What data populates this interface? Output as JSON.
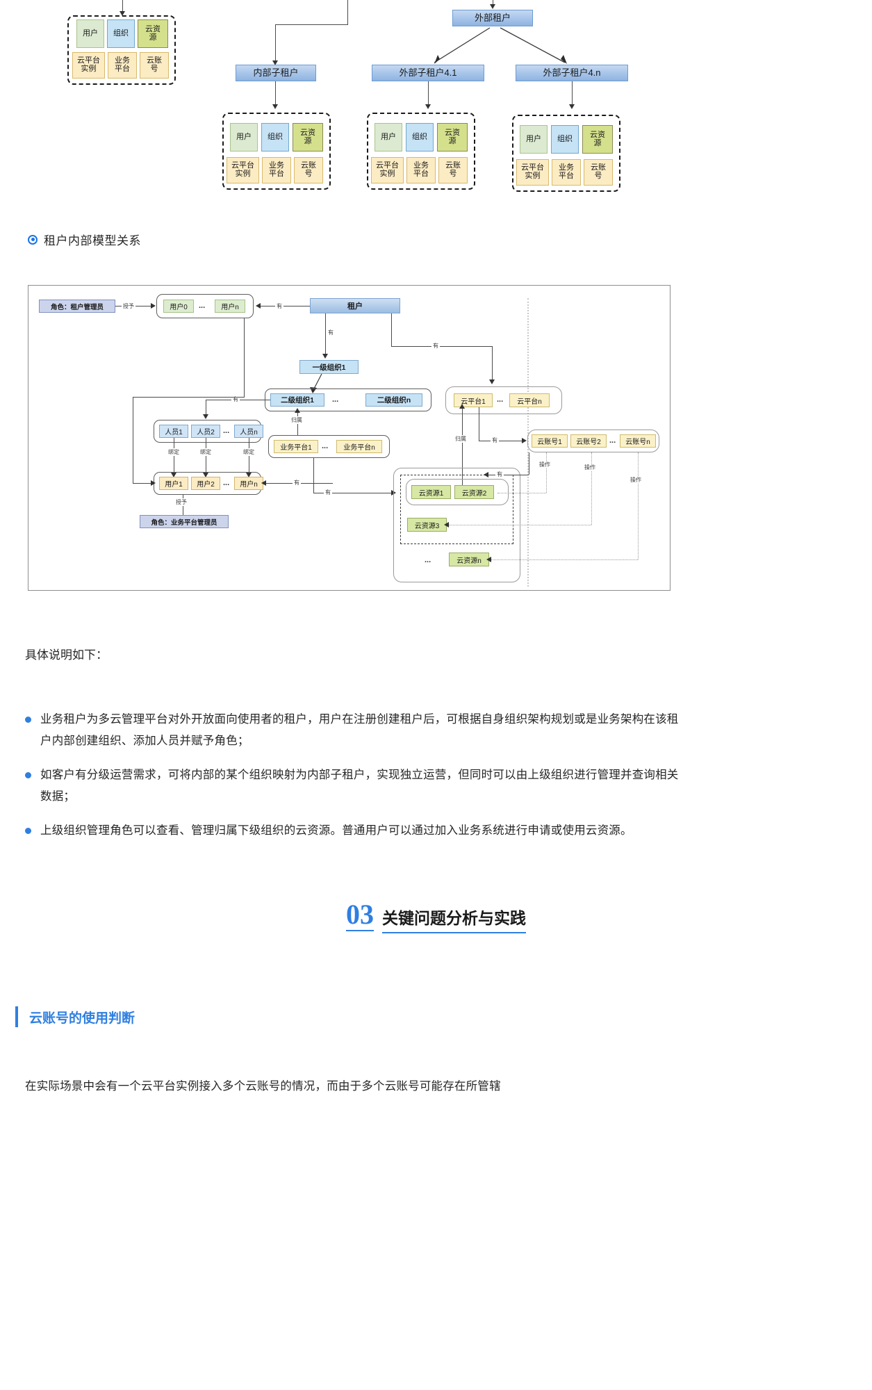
{
  "section_header": {
    "title": "租户内部模型关系"
  },
  "top_figure": {
    "tenants": [
      {
        "label": "外部租户"
      },
      {
        "label": "内部子租户"
      },
      {
        "label": "外部子租户4.1"
      },
      {
        "label": "外部子租户4.n"
      }
    ],
    "capability_group": {
      "row1": [
        "用户",
        "组织",
        "云资\n源"
      ],
      "row1_plain": [
        "用户",
        "组织",
        "云资源"
      ],
      "row2": [
        "云平台\n实例",
        "业务\n平台",
        "云账\n号"
      ],
      "row2_plain": [
        "云平台实例",
        "业务平台",
        "云账号"
      ]
    }
  },
  "model_figure": {
    "role_tenant_admin": "角色：租户管理员",
    "role_bizplat_admin": "角色：业务平台管理员",
    "tenant": "租户",
    "org_level1": "一级组织1",
    "org_level2_first": "二级组织1",
    "org_level2_last": "二级组织n",
    "users_top": [
      "用户0",
      "用户n"
    ],
    "persons": [
      "人员1",
      "人员2",
      "人员n"
    ],
    "users_bottom": [
      "用户1",
      "用户2",
      "用户n"
    ],
    "biz_platforms": [
      "业务平台1",
      "业务平台n"
    ],
    "cloud_platforms": [
      "云平台1",
      "云平台n"
    ],
    "cloud_accounts": [
      "云账号1",
      "云账号2",
      "云账号n"
    ],
    "cloud_resources": [
      "云资源1",
      "云资源2",
      "云资源3",
      "云资源n"
    ],
    "ellipsis": "...",
    "edge_labels": {
      "has": "有",
      "grant": "授予",
      "bind": "绑定",
      "belong": "归属",
      "operate": "操作"
    }
  },
  "prose": {
    "lead": "具体说明如下：",
    "bullets": [
      "业务租户为多云管理平台对外开放面向使用者的租户，用户在注册创建租户后，可根据自身组织架构规划或是业务架构在该租户内部创建组织、添加人员并赋予角色；",
      "如客户有分级运营需求，可将内部的某个组织映射为内部子租户，实现独立运营，但同时可以由上级组织进行管理并查询相关数据；",
      "上级组织管理角色可以查看、管理归属下级组织的云资源。普通用户可以通过加入业务系统进行申请或使用云资源。"
    ]
  },
  "chapter": {
    "number": "03",
    "title": "关键问题分析与实践"
  },
  "subsection": {
    "title": "云账号的使用判断"
  },
  "tail_paragraph": "在实际场景中会有一个云平台实例接入多个云账号的情况，而由于多个云账号可能存在所管辖",
  "colors": {
    "accent": "#2f7fe0",
    "tenant_blue": "#a8c6ea",
    "chip_green": "#dcead1",
    "chip_blue": "#c6e2f5",
    "chip_olive": "#d5e08d",
    "chip_cream": "#fcecc4"
  }
}
